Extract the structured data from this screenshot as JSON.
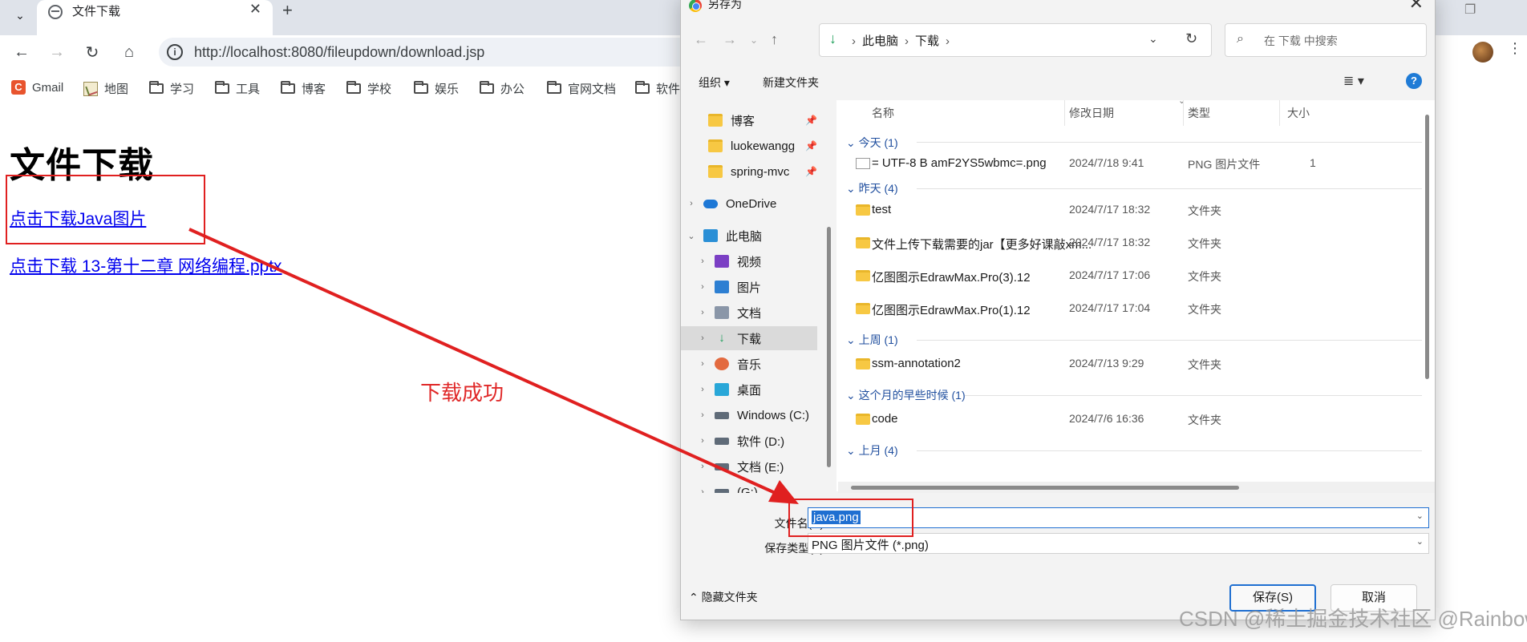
{
  "browser": {
    "tab_title": "文件下载",
    "tab_close": "✕",
    "new_tab": "+",
    "url": "http://localhost:8080/fileupdown/download.jsp",
    "bookmarks": [
      "Gmail",
      "地图",
      "学习",
      "工具",
      "博客",
      "学校",
      "娱乐",
      "办公",
      "官网文档",
      "软件"
    ]
  },
  "page": {
    "heading": "文件下载",
    "link_java": "点击下载Java图片",
    "link_pptx": "点击下载 13-第十二章 网络编程.pptx",
    "annotation_success": "下载成功"
  },
  "dialog": {
    "title": "另存为",
    "close": "✕",
    "address": [
      "此电脑",
      "下载"
    ],
    "search_placeholder": "在 下载 中搜索",
    "organize": "组织 ▾",
    "new_folder": "新建文件夹",
    "help": "?",
    "nav": [
      {
        "label": "博客",
        "icon": "folder-icon",
        "pinned": true
      },
      {
        "label": "luokewangg",
        "icon": "folder-icon",
        "pinned": true
      },
      {
        "label": "spring-mvc",
        "icon": "folder-icon",
        "pinned": true
      },
      {
        "label": "OneDrive",
        "icon": "cloud-icon",
        "pinned": false
      },
      {
        "label": "此电脑",
        "icon": "computer-icon",
        "pinned": false
      },
      {
        "label": "视频",
        "icon": "video-icon",
        "pinned": false
      },
      {
        "label": "图片",
        "icon": "picture-icon",
        "pinned": false
      },
      {
        "label": "文档",
        "icon": "document-icon",
        "pinned": false
      },
      {
        "label": "下载",
        "icon": "download-icon",
        "pinned": false
      },
      {
        "label": "音乐",
        "icon": "music-icon",
        "pinned": false
      },
      {
        "label": "桌面",
        "icon": "desktop-icon",
        "pinned": false
      },
      {
        "label": "Windows (C:)",
        "icon": "drive-icon",
        "pinned": false
      },
      {
        "label": "软件 (D:)",
        "icon": "drive-icon",
        "pinned": false
      },
      {
        "label": "文档 (E:)",
        "icon": "drive-icon",
        "pinned": false
      },
      {
        "label": "(G:)",
        "icon": "drive-icon",
        "pinned": false
      }
    ],
    "columns": [
      "名称",
      "修改日期",
      "类型",
      "大小"
    ],
    "groups": [
      {
        "label": "今天 (1)",
        "files": [
          {
            "name": "= UTF-8 B amF2YS5wbmc=.png",
            "date": "2024/7/18 9:41",
            "type": "PNG 图片文件",
            "size": "1",
            "icon": "png-file-icon"
          }
        ]
      },
      {
        "label": "昨天 (4)",
        "files": [
          {
            "name": "test",
            "date": "2024/7/17 18:32",
            "type": "文件夹",
            "size": "",
            "icon": "folder-icon"
          },
          {
            "name": "文件上传下载需要的jar【更多好课敲xm...",
            "date": "2024/7/17 18:32",
            "type": "文件夹",
            "size": "",
            "icon": "folder-icon"
          },
          {
            "name": "亿图图示EdrawMax.Pro(3).12",
            "date": "2024/7/17 17:06",
            "type": "文件夹",
            "size": "",
            "icon": "folder-icon"
          },
          {
            "name": "亿图图示EdrawMax.Pro(1).12",
            "date": "2024/7/17 17:04",
            "type": "文件夹",
            "size": "",
            "icon": "folder-icon"
          }
        ]
      },
      {
        "label": "上周 (1)",
        "files": [
          {
            "name": "ssm-annotation2",
            "date": "2024/7/13 9:29",
            "type": "文件夹",
            "size": "",
            "icon": "folder-icon"
          }
        ]
      },
      {
        "label": "这个月的早些时候 (1)",
        "files": [
          {
            "name": "code",
            "date": "2024/7/6 16:36",
            "type": "文件夹",
            "size": "",
            "icon": "folder-icon"
          }
        ]
      },
      {
        "label": "上月 (4)",
        "files": []
      }
    ],
    "filename_label": "文件名(N):",
    "filename_value": "java.png",
    "filetype_label": "保存类型(T):",
    "filetype_value": "PNG 图片文件 (*.png)",
    "hide_folders": "隐藏文件夹",
    "save": "保存(S)",
    "cancel": "取消"
  },
  "watermark": "CSDN @稀土掘金技术社区 @RainbowSea",
  "colors": {
    "annotation": "#e02020",
    "link": "#0000ee",
    "accent": "#1f6fd1",
    "folder": "#f7c843"
  }
}
